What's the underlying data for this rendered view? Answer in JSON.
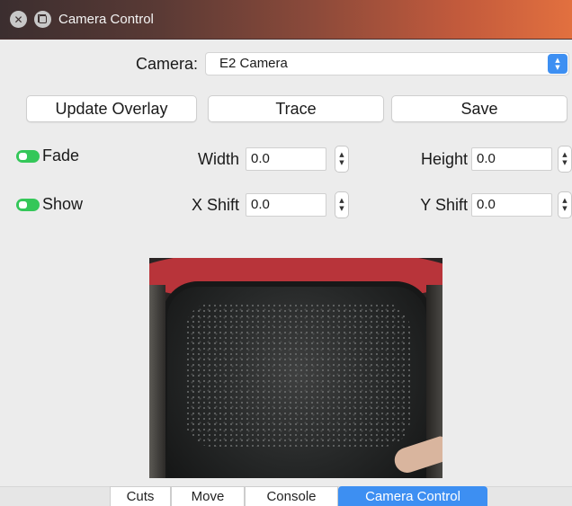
{
  "window": {
    "title": "Camera Control",
    "close_icon": "close-icon",
    "restore_icon": "restore-icon"
  },
  "camera": {
    "label": "Camera:",
    "selected": "E2 Camera"
  },
  "buttons": {
    "update_overlay": "Update Overlay",
    "trace": "Trace",
    "save": "Save"
  },
  "toggles": {
    "fade": {
      "label": "Fade",
      "on": true
    },
    "show": {
      "label": "Show",
      "on": true
    }
  },
  "fields": {
    "width": {
      "label": "Width",
      "value": "0.0"
    },
    "height": {
      "label": "Height",
      "value": "0.0"
    },
    "x_shift": {
      "label": "X Shift",
      "value": "0.0"
    },
    "y_shift": {
      "label": "Y Shift",
      "value": "0.0"
    }
  },
  "tabs": [
    {
      "label": "Cuts",
      "active": false
    },
    {
      "label": "Move",
      "active": false
    },
    {
      "label": "Console",
      "active": false
    },
    {
      "label": "Camera Control",
      "active": true
    }
  ],
  "colors": {
    "accent": "#3d8ff2",
    "toggle_on": "#34c759",
    "titlebar_end": "#e2703f"
  }
}
